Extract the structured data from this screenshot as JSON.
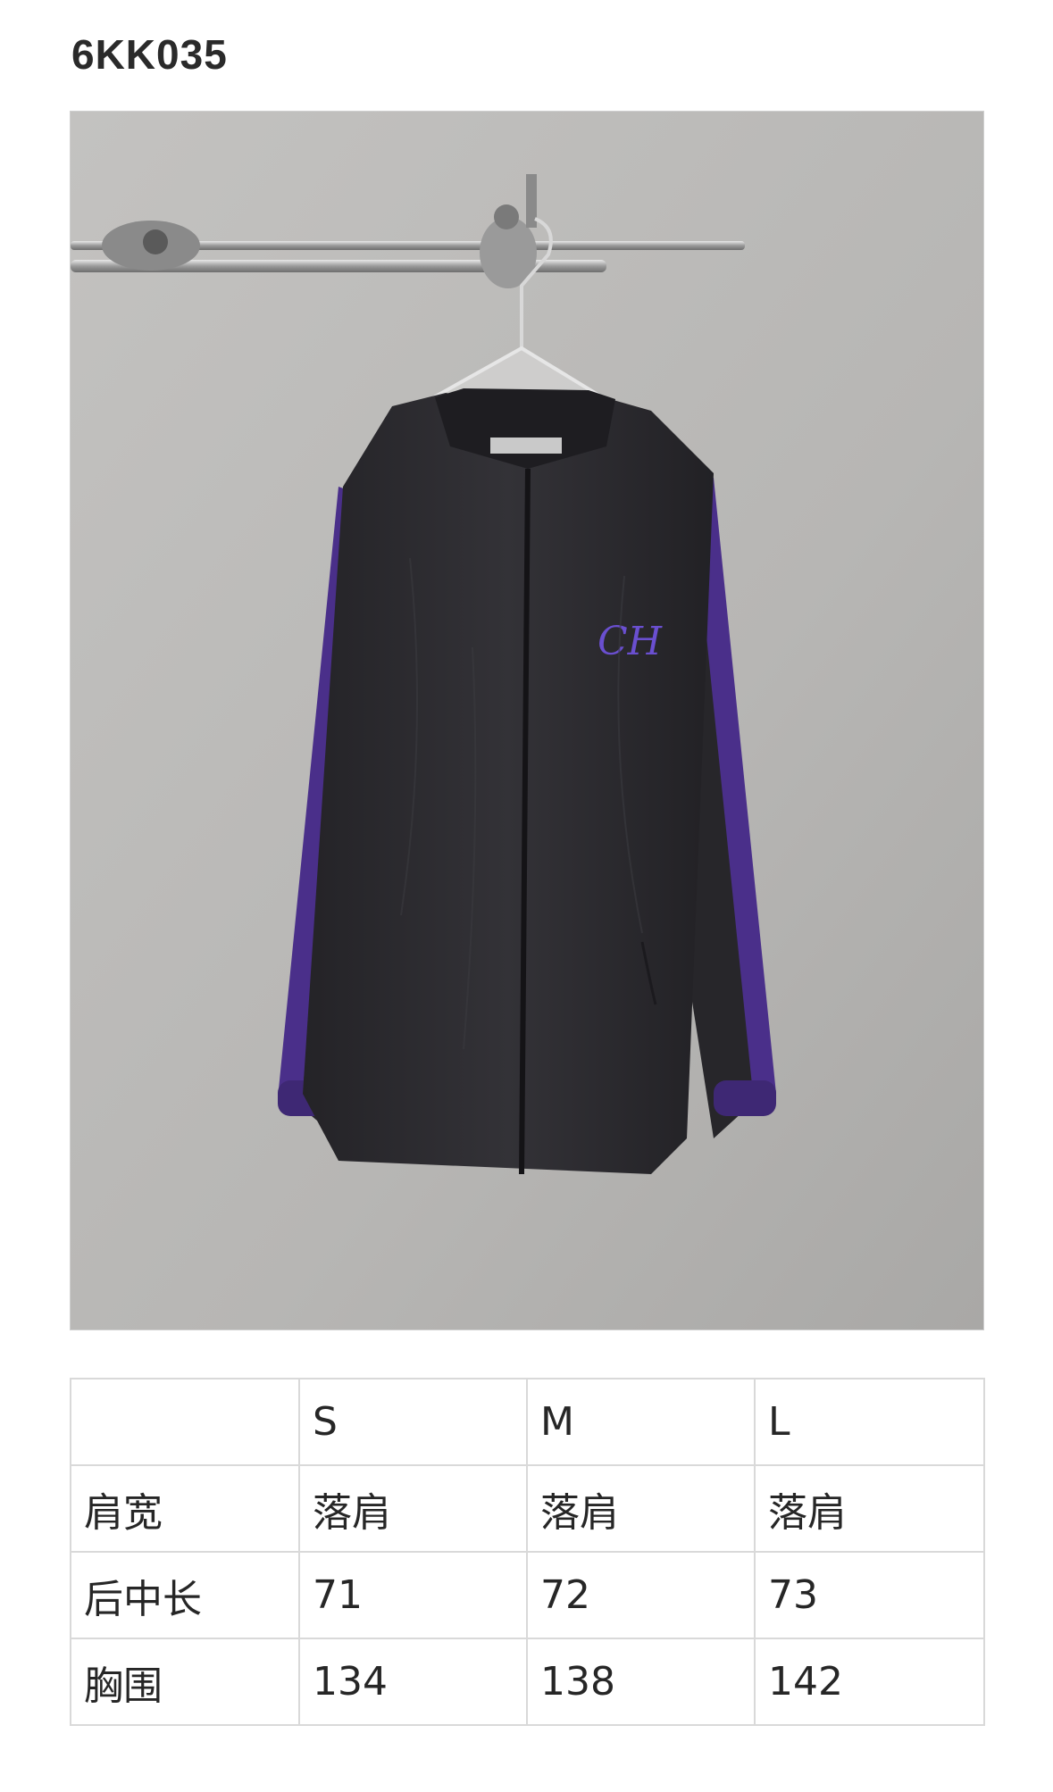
{
  "product": {
    "code": "6KK035"
  },
  "photo": {
    "subject": "jacket",
    "colors": {
      "background": "#b9b8b6",
      "jacket": "#2b2a2e",
      "stripe": "#4a2f8a",
      "embroidery": "#6a4fd0"
    }
  },
  "size_table": {
    "headers": [
      "",
      "S",
      "M",
      "L"
    ],
    "rows": [
      {
        "label": "肩宽",
        "values": [
          "落肩",
          "落肩",
          "落肩"
        ]
      },
      {
        "label": "后中长",
        "values": [
          "71",
          "72",
          "73"
        ]
      },
      {
        "label": "胸围",
        "values": [
          "134",
          "138",
          "142"
        ]
      }
    ]
  }
}
